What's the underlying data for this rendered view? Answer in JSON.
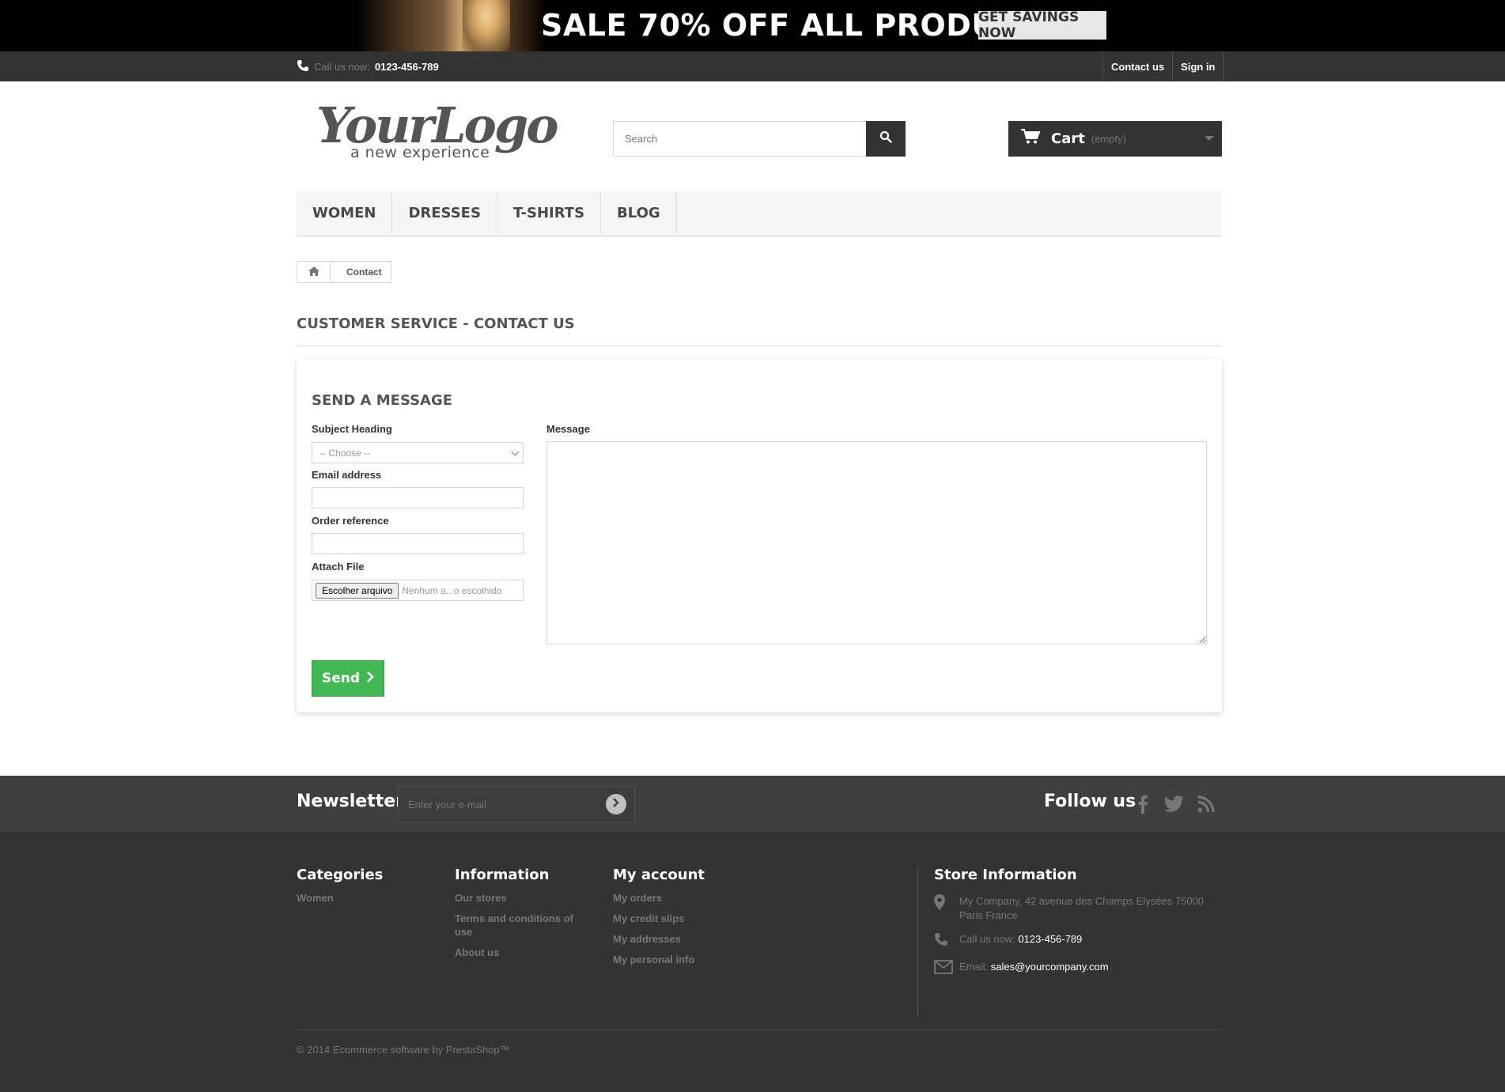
{
  "banner": {
    "text": "SALE 70% OFF ALL PRODUCTS",
    "button": "GET SAVINGS NOW"
  },
  "topnav": {
    "call_label": "Call us now:",
    "phone": "0123-456-789",
    "contact": "Contact us",
    "signin": "Sign in"
  },
  "logo": {
    "script": "YourLogo",
    "tagline": "a new experience"
  },
  "search": {
    "placeholder": "Search"
  },
  "cart": {
    "label": "Cart",
    "status": "(empty)"
  },
  "menu": {
    "items": [
      "WOMEN",
      "DRESSES",
      "T-SHIRTS",
      "BLOG"
    ]
  },
  "breadcrumb": {
    "current": "Contact"
  },
  "page": {
    "title": "CUSTOMER SERVICE - CONTACT US"
  },
  "form": {
    "heading": "SEND A MESSAGE",
    "subject_label": "Subject Heading",
    "subject_value": "-- Choose --",
    "email_label": "Email address",
    "email_value": "",
    "order_label": "Order reference",
    "order_value": "",
    "attach_label": "Attach File",
    "file_button": "Escolher arquivo",
    "file_name": "Nenhum a...o escolhido",
    "message_label": "Message",
    "message_value": "",
    "send": "Send"
  },
  "newsletter": {
    "title": "Newsletter",
    "placeholder": "Enter your e-mail",
    "follow": "Follow us",
    "social": [
      "facebook-icon",
      "twitter-icon",
      "rss-icon"
    ]
  },
  "footer": {
    "categories": {
      "title": "Categories",
      "items": [
        "Women"
      ]
    },
    "information": {
      "title": "Information",
      "items": [
        "Our stores",
        "Terms and conditions of use",
        "About us"
      ]
    },
    "account": {
      "title": "My account",
      "items": [
        "My orders",
        "My credit slips",
        "My addresses",
        "My personal info"
      ]
    },
    "store": {
      "title": "Store Information",
      "address": "My Company, 42 avenue des Champs Elysées 75000 Paris France",
      "call_label": "Call us now:",
      "phone": "0123-456-789",
      "email_label": "Email:",
      "email": "sales@yourcompany.com"
    },
    "copyright": "© 2014 Ecommerce software by PrestaShop™"
  },
  "colors": {
    "dark": "#333333",
    "send_green": "#43b754",
    "menu_bg": "#f6f6f6"
  }
}
